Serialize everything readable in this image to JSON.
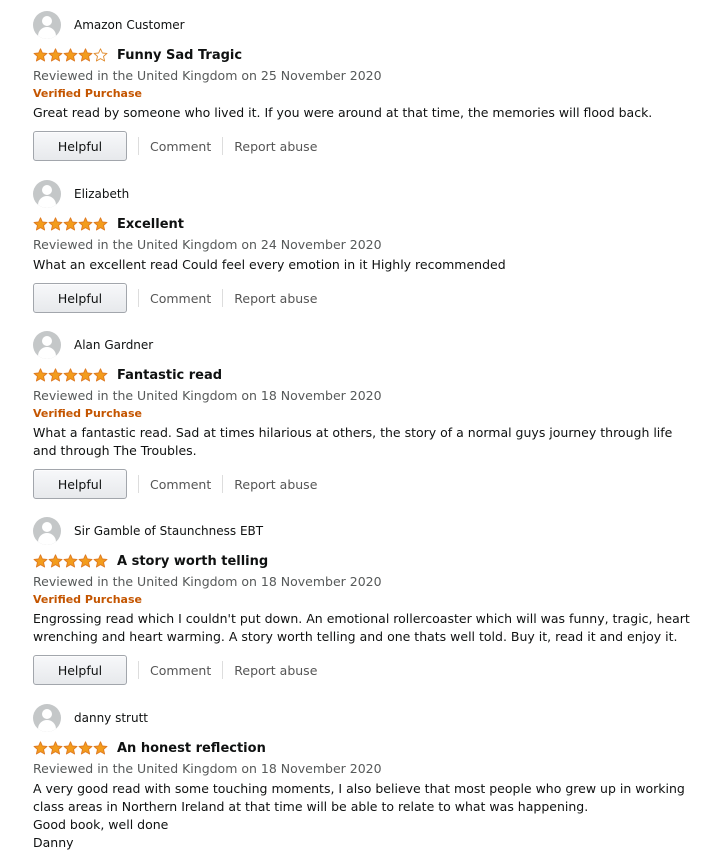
{
  "colors": {
    "star_fill": "#f39c1c",
    "verified": "#c45500",
    "date_text": "#565959"
  },
  "labels": {
    "helpful": "Helpful",
    "comment": "Comment",
    "report_abuse": "Report abuse"
  },
  "reviews": [
    {
      "author": "Amazon Customer",
      "rating": 4,
      "title": "Funny Sad Tragic",
      "date": "Reviewed in the United Kingdom on 25 November 2020",
      "verified": "Verified Purchase",
      "body": "Great read by someone who lived it. If you were around at that time, the memories will flood back."
    },
    {
      "author": "Elizabeth",
      "rating": 5,
      "title": "Excellent",
      "date": "Reviewed in the United Kingdom on 24 November 2020",
      "verified": "",
      "body": "What an excellent read Could feel every emotion in it Highly recommended"
    },
    {
      "author": "Alan Gardner",
      "rating": 5,
      "title": "Fantastic read",
      "date": "Reviewed in the United Kingdom on 18 November 2020",
      "verified": "Verified Purchase",
      "body": "What a fantastic read. Sad at times hilarious at others, the story of a normal guys journey through life and through The Troubles."
    },
    {
      "author": "Sir Gamble of Staunchness EBT",
      "rating": 5,
      "title": "A story worth telling",
      "date": "Reviewed in the United Kingdom on 18 November 2020",
      "verified": "Verified Purchase",
      "body": "Engrossing read which I couldn't put down. An emotional rollercoaster which will was funny, tragic, heart wrenching and heart warming. A story worth telling and one thats well told. Buy it, read it and enjoy it."
    },
    {
      "author": "danny strutt",
      "rating": 5,
      "title": "An honest reflection",
      "date": "Reviewed in the United Kingdom on 18 November 2020",
      "verified": "",
      "body": "A very good read with some touching moments, I also believe that most people who grew up in working class areas in Northern Ireland at that time will be able to relate to what was happening.\nGood book, well done\nDanny"
    }
  ]
}
